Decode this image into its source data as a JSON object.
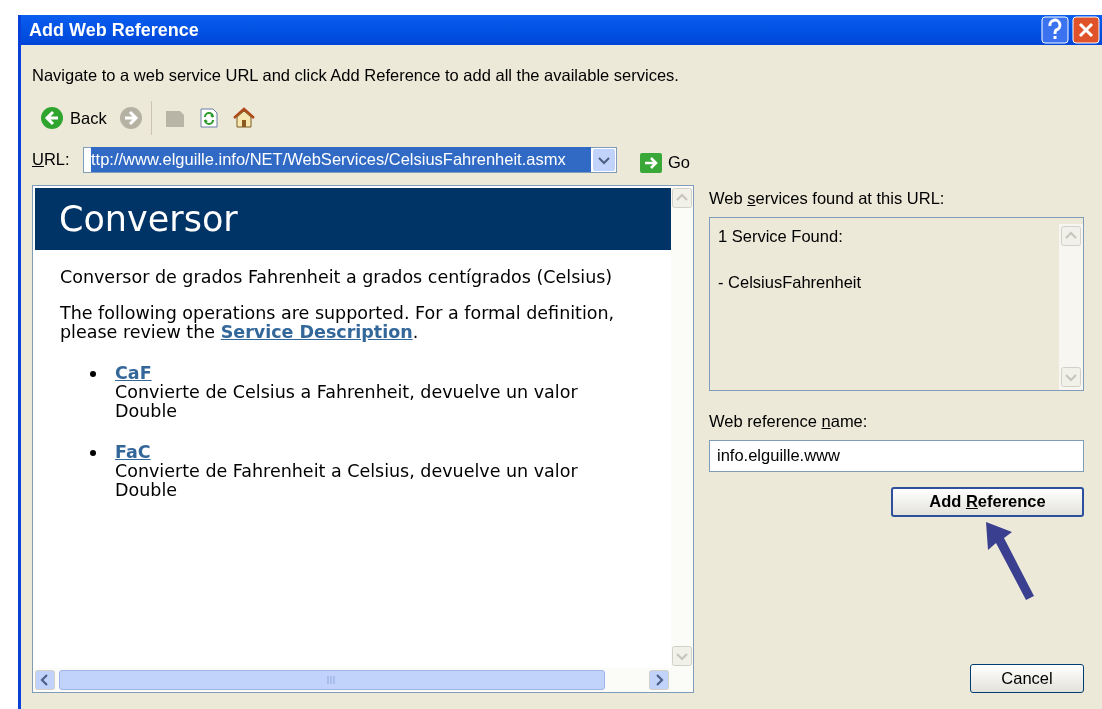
{
  "window": {
    "title": "Add Web Reference"
  },
  "instructions": "Navigate to a web service URL and click Add Reference to add all the available services.",
  "toolbar": [
    {
      "kind": "back",
      "label": "Back",
      "disabled": false
    },
    {
      "kind": "forward",
      "disabled": true
    },
    {
      "kind": "stop",
      "disabled": true
    },
    {
      "kind": "refresh",
      "disabled": false
    },
    {
      "kind": "home",
      "disabled": false
    }
  ],
  "url": {
    "label": [
      {
        "text": "U",
        "underline": true
      },
      {
        "text": "RL:",
        "underline": false
      }
    ],
    "value": "ttp://www.elguille.info/NET/WebServices/CelsiusFahrenheit.asmx",
    "selected": true
  },
  "go_button": {
    "label": "Go"
  },
  "browser": {
    "heading": "Conversor",
    "description": "Conversor de grados Fahrenheit a grados centígrados (Celsius)",
    "intro": "The following operations are supported. For a formal definition, please review the",
    "link": "Service Description",
    "intro_end": ".",
    "operations": [
      {
        "name": "CaF",
        "description": "Convierte de Celsius a Fahrenheit, devuelve un valor Double"
      },
      {
        "name": "FaC",
        "description": "Convierte de Fahrenheit a Celsius, devuelve un valor Double"
      }
    ]
  },
  "services": {
    "label": [
      {
        "text": "Web ",
        "underline": false
      },
      {
        "text": "s",
        "underline": true
      },
      {
        "text": "ervices found at this URL:",
        "underline": false
      }
    ],
    "lines": [
      "1 Service Found:",
      "- CelsiusFahrenheit"
    ]
  },
  "reference_name": {
    "label": [
      {
        "text": "Web reference ",
        "underline": false
      },
      {
        "text": "n",
        "underline": true
      },
      {
        "text": "ame:",
        "underline": false
      }
    ],
    "value": "info.elguille.www"
  },
  "add_button": {
    "label": [
      {
        "text": "Add ",
        "underline": false
      },
      {
        "text": "R",
        "underline": true
      },
      {
        "text": "eference",
        "underline": false
      }
    ]
  },
  "cancel_button": {
    "label": "Cancel"
  }
}
